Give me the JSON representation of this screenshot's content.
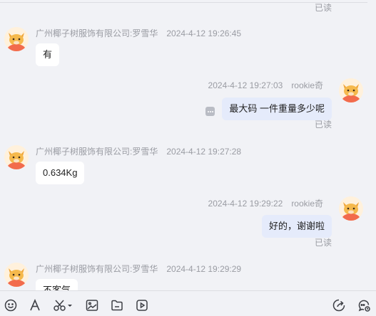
{
  "chat": {
    "top_read_status": "已读",
    "messages": [
      {
        "side": "left",
        "sender": "广州椰子树服饰有限公司:罗雪华",
        "time": "2024-4-12 19:26:45",
        "text": "有"
      },
      {
        "side": "right",
        "sender": "rookie奇",
        "time": "2024-4-12 19:27:03",
        "text": "最大码 一件重量多少呢",
        "status": "已读"
      },
      {
        "side": "left",
        "sender": "广州椰子树服饰有限公司:罗雪华",
        "time": "2024-4-12 19:27:28",
        "text": "0.634Kg"
      },
      {
        "side": "right",
        "sender": "rookie奇",
        "time": "2024-4-12 19:29:22",
        "text": "好的，谢谢啦",
        "status": "已读"
      },
      {
        "side": "left",
        "sender": "广州椰子树服饰有限公司:罗雪华",
        "time": "2024-4-12 19:29:29",
        "text": "不客气"
      }
    ]
  },
  "toolbar": {
    "left_icons": [
      "emoji-icon",
      "font-icon",
      "scissors-icon",
      "image-icon",
      "file-icon",
      "video-icon"
    ],
    "right_icons": [
      "share-icon",
      "chat-history-icon"
    ]
  },
  "colors": {
    "background": "#f1f2f6",
    "bubble_left": "#ffffff",
    "bubble_right": "#e5ebfb",
    "meta_text": "#9a9ca3"
  }
}
